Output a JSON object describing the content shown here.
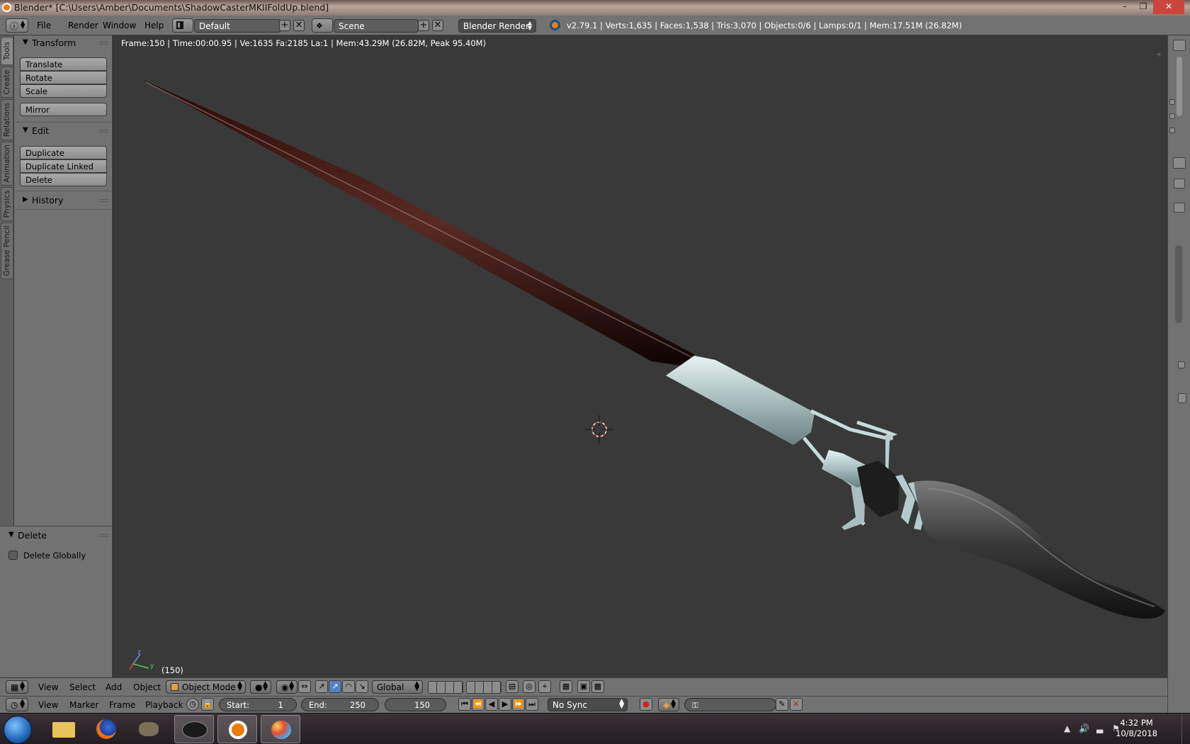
{
  "window": {
    "title": "Blender* [C:\\Users\\Amber\\Documents\\ShadowCasterMKIIFoldUp.blend]"
  },
  "info_header": {
    "menus": [
      "File",
      "Render",
      "Window",
      "Help"
    ],
    "screen_layout": "Default",
    "scene": "Scene",
    "render_engine": "Blender Render",
    "stats": "v2.79.1 | Verts:1,635 | Faces:1,538 | Tris:3,070 | Objects:0/6 | Lamps:0/1 | Mem:17.51M (26.82M)"
  },
  "tool_tabs": [
    "Tools",
    "Create",
    "Relations",
    "Animation",
    "Physics",
    "Grease Pencil"
  ],
  "tool_shelf": {
    "transform": {
      "title": "Transform",
      "buttons": [
        "Translate",
        "Rotate",
        "Scale",
        "Mirror"
      ]
    },
    "edit": {
      "title": "Edit",
      "buttons": [
        "Duplicate",
        "Duplicate Linked",
        "Delete"
      ]
    },
    "history": {
      "title": "History"
    }
  },
  "operator_panel": {
    "title": "Delete",
    "option_label": "Delete Globally",
    "option_checked": false
  },
  "viewport": {
    "info": "Frame:150 | Time:00:00.95 | Ve:1635 Fa:2185 La:1 | Mem:43.29M (26.82M, Peak 95.40M)",
    "frame_indicator": "(150)",
    "axis_labels": {
      "z": "z",
      "y": "y"
    }
  },
  "view3d_header": {
    "menus": [
      "View",
      "Select",
      "Add",
      "Object"
    ],
    "mode": "Object Mode",
    "orientation": "Global"
  },
  "timeline_header": {
    "menus": [
      "View",
      "Marker",
      "Frame",
      "Playback"
    ],
    "start_label": "Start:",
    "start_value": "1",
    "end_label": "End:",
    "end_value": "250",
    "current_frame": "150",
    "sync": "No Sync"
  },
  "taskbar": {
    "time": "4:32 PM",
    "date": "10/8/2018"
  },
  "colors": {
    "panel": "#727272",
    "viewport": "#393939",
    "accent": "#5680c2"
  }
}
